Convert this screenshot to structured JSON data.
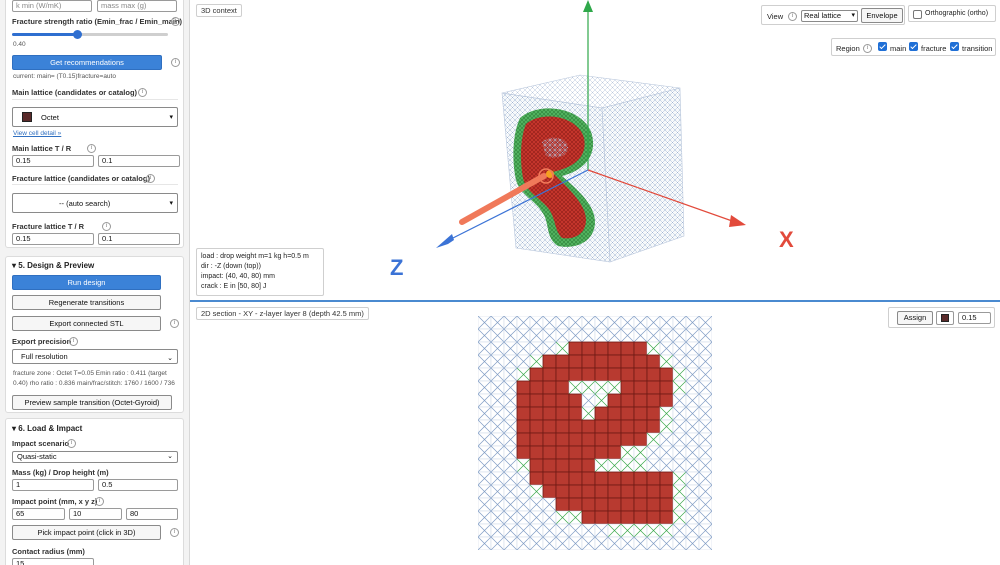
{
  "sidebar": {
    "top_inputs": {
      "k_min_placeholder": "k min (W/mK)",
      "mass_max_placeholder": "mass max (g)"
    },
    "strength_ratio": {
      "label": "Fracture strength ratio (Emin_frac / Emin_main)",
      "value": "0.40",
      "slider_fraction": 0.4
    },
    "recommend_button": "Get recommendations",
    "current_text": "current: main= (T0.15)fracture=auto",
    "main_lattice": {
      "label": "Main lattice (candidates or catalog)",
      "selected": "Octet",
      "view_link": "View cell detail »"
    },
    "main_tr": {
      "label": "Main lattice T / R",
      "t": "0.15",
      "r": "0.1"
    },
    "fracture_lattice": {
      "label": "Fracture lattice (candidates or catalog)",
      "selected": "-- (auto search)"
    },
    "fracture_tr": {
      "label": "Fracture lattice T / R",
      "t": "0.15",
      "r": "0.1"
    },
    "design": {
      "title": "5. Design & Preview",
      "run_button": "Run design",
      "regen_button": "Regenerate transitions",
      "export_button": "Export connected STL",
      "precision_label": "Export precision",
      "precision_value": "Full resolution",
      "summary_line1": "fracture zone : Octet T=0.05 Emin ratio : 0.411 (target",
      "summary_line2": "0.40) rho ratio : 0.836 main/frac/stitch: 1760 / 1600 / 736",
      "preview_button": "Preview sample transition (Octet-Gyroid)"
    },
    "impact": {
      "title": "6. Load & Impact",
      "scenario_label": "Impact scenario",
      "scenario_value": "Quasi-static",
      "mass_label": "Mass (kg) / Drop height (m)",
      "mass": "1",
      "height": "0.5",
      "point_label": "Impact point (mm, x y z)",
      "px": "65",
      "py": "10",
      "pz": "80",
      "pick_button": "Pick impact point (click in 3D)",
      "radius_label": "Contact radius (mm)",
      "radius": "15"
    }
  },
  "view3d": {
    "context_tag": "3D context",
    "view_label": "View",
    "view_select": "Real lattice",
    "envelope_button": "Envelope",
    "ortho_label": "Orthographic (ortho)",
    "region_label": "Region",
    "regions": [
      {
        "label": "main",
        "checked": true
      },
      {
        "label": "fracture",
        "checked": true
      },
      {
        "label": "transition",
        "checked": true
      }
    ],
    "axes": {
      "x": "X",
      "z": "Z"
    },
    "load_lines": [
      "load  : drop weight  m=1 kg  h=0.5 m",
      "dir    : -Z (down (top))",
      "impact: (40, 40, 80) mm",
      "crack : E in [50, 80] J"
    ],
    "colors": {
      "main": "#a9bcd6",
      "fracture": "#c0392b",
      "transition": "#3aa84a",
      "accent": "#3b82d8"
    }
  },
  "view2d": {
    "section_tag": "2D section - XY - z-layer layer 8 (depth 42.5 mm)",
    "assign_button": "Assign",
    "assign_value": "0.15",
    "grid_rows": [
      "..................",
      "..................",
      "......TFFFFFFT....",
      "....TFFFFFFFFFT...",
      "...TFFFFFFFFFFFT..",
      "...FFFFTTTTFFFFT..",
      "...FFFFF.TFFFFF...",
      "...FFFFFTFFFFFT...",
      "...FFFFFFFFFFFT...",
      "...FFFFFFFFFFT....",
      "...FFFFFFFFTT.....",
      "...TFFFFFTTTT.....",
      "....FFFFFFFFFFFT..",
      "....TFFFFFFFFFFT..",
      "......FFFFFFFFFT..",
      "......TTFFFFFFFT..",
      "..........TTTTT...",
      ".................."
    ]
  }
}
